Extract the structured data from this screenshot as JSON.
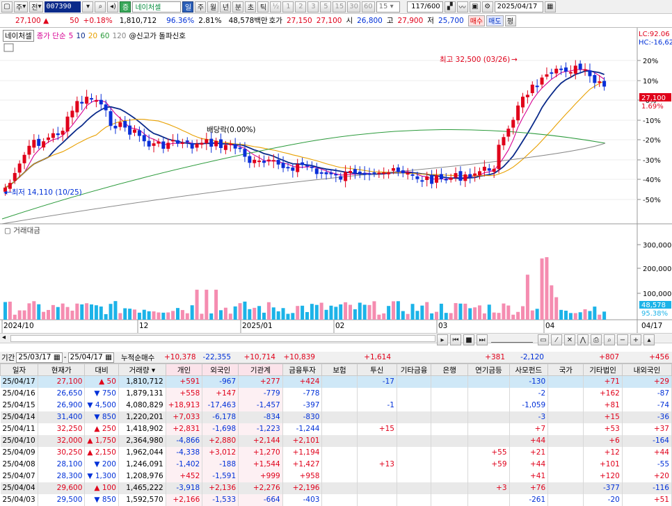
{
  "toolbar": {
    "market": "주",
    "total": "전",
    "code": "007390",
    "name_badge": "증",
    "name": "네이처셀",
    "periods": [
      "일",
      "주",
      "월",
      "년",
      "분",
      "초",
      "틱"
    ],
    "half": "½",
    "minutes": [
      "1",
      "2",
      "3",
      "5",
      "15",
      "30",
      "60"
    ],
    "minute_sel": "15",
    "count": "117/600",
    "date": "2025/04/17"
  },
  "quote": {
    "price": "27,100",
    "change": "50",
    "change_pct": "+0.18%",
    "volume": "1,810,712",
    "vol_ratio": "96.36%",
    "turnover": "2.81%",
    "amount": "48,578백만",
    "bid_label": "호가",
    "ask": "27,150",
    "bid": "27,100",
    "open_label": "시",
    "open": "26,800",
    "high_label": "고",
    "high": "27,900",
    "low_label": "저",
    "low": "25,700",
    "buy": "매수",
    "sell": "매도",
    "eval": "평"
  },
  "legend": {
    "name": "네이처셀",
    "ma_label": "종가 단순",
    "ma": [
      "5",
      "10",
      "20",
      "60",
      "120"
    ],
    "signal": "@신고가 돌파신호"
  },
  "chart_data": {
    "type": "candlestick",
    "x": [
      "2024/10",
      "12",
      "2025/01",
      "02",
      "03",
      "04"
    ],
    "y_ticks": [
      "20%",
      "10%",
      "-0%",
      "-10%",
      "-20%",
      "-30%",
      "-40%",
      "-50%"
    ],
    "annotations": {
      "lc": "LC:92.06",
      "hc": "HC:-16,62",
      "max": "최고 32,500 (03/26)",
      "min": "최저 14,110 (10/25)",
      "dividend": "배당락(0.00%)",
      "last_price": "27,100",
      "last_pct": "1.69%"
    },
    "volume_title": "거래대금",
    "volume_ticks": [
      "300,000",
      "200,000",
      "100,000"
    ],
    "volume_last": "48,578",
    "volume_last_pct": "95.38%",
    "date_right": "04/17",
    "colors": {
      "up": "#e0001a",
      "down": "#0a2fd8",
      "ma5": "#d70093",
      "ma10": "#0a2a8a",
      "ma20": "#e8a000",
      "ma60": "#2a9a3a",
      "ma120": "#888888",
      "vol_up": "#f58cb0",
      "vol_down": "#1cb3e8"
    }
  },
  "period": {
    "label": "기간",
    "from": "25/03/17",
    "to": "25/04/17",
    "sum_label": "누적순매수",
    "sums": [
      "+10,378",
      "-22,355",
      "+10,714",
      "+10,839",
      "",
      "+1,614",
      "",
      "",
      "+381",
      "-2,120",
      "",
      "+807",
      "+456"
    ]
  },
  "table": {
    "headers": [
      "일자",
      "현재가",
      "대비",
      "거래량",
      "개인",
      "외국인",
      "기관계",
      "금융투자",
      "보험",
      "투신",
      "기타금융",
      "은행",
      "연기금등",
      "사모펀드",
      "국가",
      "기타법인",
      "내외국인"
    ],
    "rows": [
      {
        "d": "25/04/17",
        "p": "27,100",
        "dir": "up",
        "c": "50",
        "v": "1,810,712",
        "cells": [
          "+591",
          "-967",
          "+277",
          "+424",
          "",
          "-17",
          "",
          "",
          "",
          "-130",
          "",
          "+71",
          "+29"
        ]
      },
      {
        "d": "25/04/16",
        "p": "26,650",
        "dir": "dn",
        "c": "750",
        "v": "1,879,131",
        "cells": [
          "+558",
          "+147",
          "-779",
          "-778",
          "",
          "",
          "",
          "",
          "",
          "-2",
          "",
          "+162",
          "-87"
        ]
      },
      {
        "d": "25/04/15",
        "p": "26,900",
        "dir": "dn",
        "c": "4,500",
        "v": "4,080,829",
        "cells": [
          "+18,913",
          "-17,463",
          "-1,457",
          "-397",
          "",
          "-1",
          "",
          "",
          "",
          "-1,059",
          "",
          "+81",
          "-74"
        ]
      },
      {
        "d": "25/04/14",
        "p": "31,400",
        "dir": "dn",
        "c": "850",
        "v": "1,220,201",
        "cells": [
          "+7,033",
          "-6,178",
          "-834",
          "-830",
          "",
          "",
          "",
          "",
          "",
          "-3",
          "",
          "+15",
          "-36"
        ]
      },
      {
        "d": "25/04/11",
        "p": "32,250",
        "dir": "up",
        "c": "250",
        "v": "1,418,902",
        "cells": [
          "+2,831",
          "-1,698",
          "-1,223",
          "-1,244",
          "",
          "+15",
          "",
          "",
          "",
          "+7",
          "",
          "+53",
          "+37"
        ]
      },
      {
        "d": "25/04/10",
        "p": "32,000",
        "dir": "up",
        "c": "1,750",
        "v": "2,364,980",
        "cells": [
          "-4,866",
          "+2,880",
          "+2,144",
          "+2,101",
          "",
          "",
          "",
          "",
          "",
          "+44",
          "",
          "+6",
          "-164"
        ]
      },
      {
        "d": "25/04/09",
        "p": "30,250",
        "dir": "up",
        "c": "2,150",
        "v": "1,962,044",
        "cells": [
          "-4,338",
          "+3,012",
          "+1,270",
          "+1,194",
          "",
          "",
          "",
          "",
          "+55",
          "+21",
          "",
          "+12",
          "+44"
        ]
      },
      {
        "d": "25/04/08",
        "p": "28,100",
        "dir": "dn",
        "c": "200",
        "v": "1,246,091",
        "cells": [
          "-1,402",
          "-188",
          "+1,544",
          "+1,427",
          "",
          "+13",
          "",
          "",
          "+59",
          "+44",
          "",
          "+101",
          "-55"
        ]
      },
      {
        "d": "25/04/07",
        "p": "28,300",
        "dir": "dn",
        "c": "1,300",
        "v": "1,208,976",
        "cells": [
          "+452",
          "-1,591",
          "+999",
          "+958",
          "",
          "",
          "",
          "",
          "",
          "+41",
          "",
          "+120",
          "+20"
        ]
      },
      {
        "d": "25/04/04",
        "p": "29,600",
        "dir": "up",
        "c": "100",
        "v": "1,465,222",
        "cells": [
          "-3,918",
          "+2,136",
          "+2,276",
          "+2,196",
          "",
          "",
          "",
          "",
          "+3",
          "+76",
          "",
          "-377",
          "-116"
        ]
      },
      {
        "d": "25/04/03",
        "p": "29,500",
        "dir": "dn",
        "c": "850",
        "v": "1,592,570",
        "cells": [
          "+2,166",
          "-1,533",
          "-664",
          "-403",
          "",
          "",
          "",
          "",
          "",
          "-261",
          "",
          "-20",
          "+51"
        ]
      }
    ]
  }
}
